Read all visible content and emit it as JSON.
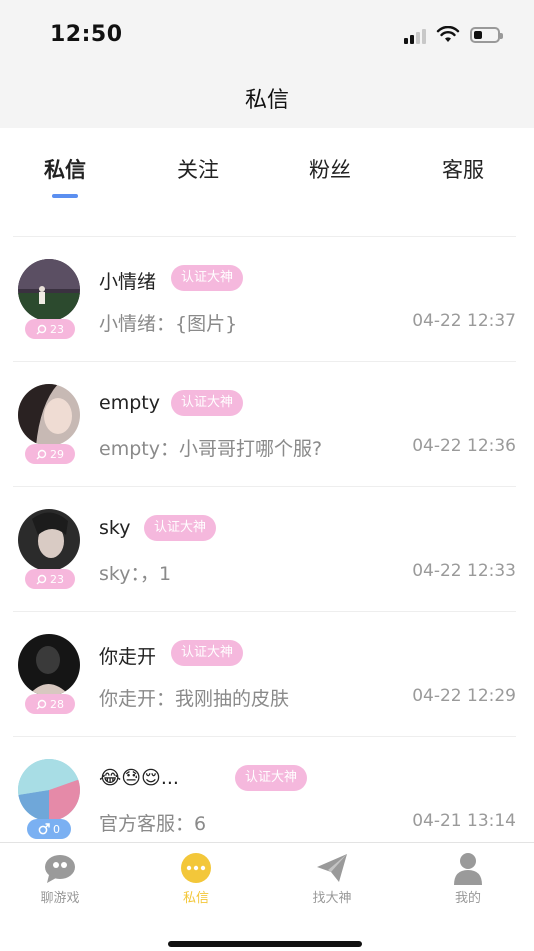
{
  "status": {
    "time": "12:50"
  },
  "header": {
    "title": "私信"
  },
  "tabs": [
    {
      "label": "私信",
      "active": true
    },
    {
      "label": "关注",
      "active": false
    },
    {
      "label": "粉丝",
      "active": false
    },
    {
      "label": "客服",
      "active": false
    }
  ],
  "badge_label": "认证大神",
  "conversations": [
    {
      "name": "小情绪",
      "preview": "小情绪：{图片}",
      "time": "04-22 12:37",
      "count": "23",
      "gender": "female"
    },
    {
      "name": "empty",
      "preview": "empty：小哥哥打哪个服?",
      "time": "04-22 12:36",
      "count": "29",
      "gender": "female"
    },
    {
      "name": "sky",
      "preview": "sky：，1",
      "time": "04-22 12:33",
      "count": "23",
      "gender": "female"
    },
    {
      "name": "你走开",
      "preview": "你走开：我刚抽的皮肤",
      "time": "04-22 12:29",
      "count": "28",
      "gender": "female"
    },
    {
      "name": "😂😓😌...",
      "preview": "官方客服：6",
      "time": "04-21 13:14",
      "count": "0",
      "gender": "male"
    }
  ],
  "bottom_nav": [
    {
      "label": "聊游戏",
      "icon": "chat-game-icon",
      "active": false
    },
    {
      "label": "私信",
      "icon": "message-bubble-icon",
      "active": true
    },
    {
      "label": "找大神",
      "icon": "paper-plane-icon",
      "active": false
    },
    {
      "label": "我的",
      "icon": "person-icon",
      "active": false
    }
  ],
  "colors": {
    "accent_blue": "#5b8ff0",
    "badge_pink": "#f5b8dd",
    "active_yellow": "#f3c73a",
    "male_blue": "#7ab0f2"
  }
}
